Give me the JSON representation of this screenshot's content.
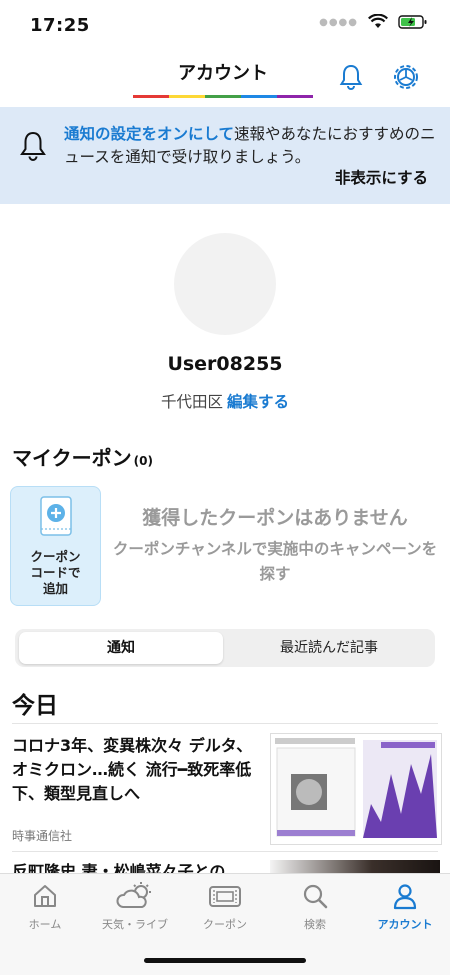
{
  "status": {
    "time": "17:25"
  },
  "header": {
    "title": "アカウント"
  },
  "banner": {
    "link_text": "通知の設定をオンにして",
    "text": "速報やあなたにおすすめのニュースを通知で受け取りましょう。",
    "dismiss": "非表示にする"
  },
  "profile": {
    "username": "User08255",
    "location": "千代田区",
    "edit": "編集する"
  },
  "coupons": {
    "heading": "マイクーポン",
    "count": "(0)",
    "add_card_label": "クーポン\nコードで\n追加",
    "empty_title": "獲得したクーポンはありません",
    "empty_sub": "クーポンチャンネルで実施中のキャンペーンを探す"
  },
  "segments": {
    "active": "通知",
    "inactive": "最近読んだ記事"
  },
  "feed": {
    "section": "今日",
    "items": [
      {
        "title": "コロナ3年、変異株次々 デルタ、オミクロン…続く 流行━致死率低下、類型見直しへ",
        "source": "時事通信社"
      },
      {
        "title": "反町隆史 妻・松嶋菜々子との"
      }
    ]
  },
  "tabbar": {
    "items": [
      {
        "label": "ホーム"
      },
      {
        "label": "天気・ライブ"
      },
      {
        "label": "クーポン"
      },
      {
        "label": "検索"
      },
      {
        "label": "アカウント"
      }
    ]
  },
  "colors": {
    "accent": "#1a7bd1",
    "banner_bg": "#dde9f7"
  }
}
